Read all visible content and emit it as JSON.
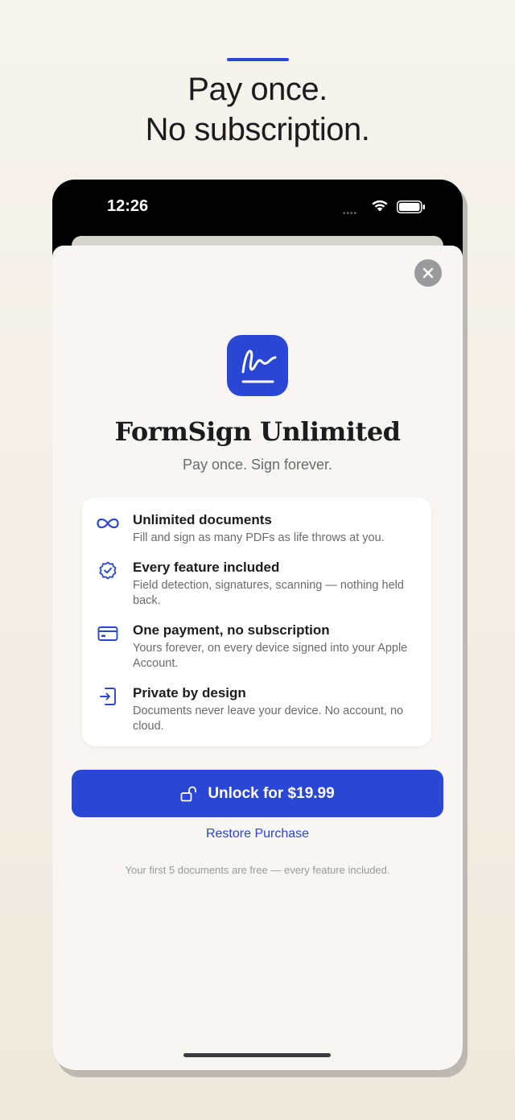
{
  "headline": {
    "line1": "Pay once.",
    "line2": "No subscription."
  },
  "status_bar": {
    "time": "12:26",
    "dots": "••••"
  },
  "paywall": {
    "title": "FormSign Unlimited",
    "subtitle": "Pay once. Sign forever.",
    "features": [
      {
        "icon": "infinity-icon",
        "title": "Unlimited documents",
        "description": "Fill and sign as many PDFs as life throws at you."
      },
      {
        "icon": "checkmark-seal-icon",
        "title": "Every feature included",
        "description": "Field detection, signatures, scanning — nothing held back."
      },
      {
        "icon": "credit-card-icon",
        "title": "One payment, no subscription",
        "description": "Yours forever, on every device signed into your Apple Account."
      },
      {
        "icon": "lock-device-icon",
        "title": "Private by design",
        "description": "Documents never leave your device. No account, no cloud."
      }
    ],
    "unlock_label": "Unlock for $19.99",
    "restore_label": "Restore Purchase",
    "footnote": "Your first 5 documents are free — every feature included."
  },
  "colors": {
    "accent": "#2a46d4",
    "background": "#f7f4ee",
    "sheet": "#f8f6f2"
  }
}
